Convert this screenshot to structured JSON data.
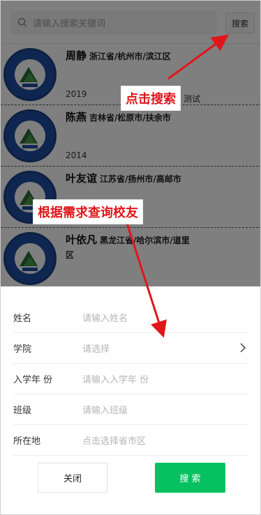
{
  "search": {
    "placeholder": "请输入搜索关键词",
    "button_label": "搜索"
  },
  "alumni": [
    {
      "name": "周静",
      "address": "浙江省/杭州市/滨江区",
      "extra": "测试",
      "year": "2019"
    },
    {
      "name": "陈燕",
      "address": "吉林省/松原市/扶余市",
      "extra": "",
      "year": "2014"
    },
    {
      "name": "叶友谊",
      "address": "江苏省/扬州市/高邮市",
      "extra": "",
      "year": ""
    },
    {
      "name": "叶依凡",
      "address": "黑龙江省/哈尔滨市/道里",
      "address_cont": "区",
      "extra": "",
      "year": ""
    }
  ],
  "filter": {
    "fields": [
      {
        "label": "姓名",
        "placeholder": "请输入姓名"
      },
      {
        "label": "学院",
        "placeholder": "请选择"
      },
      {
        "label": "入学年 份",
        "placeholder": "请输入入学年 份"
      },
      {
        "label": "班级",
        "placeholder": "请输入班级"
      },
      {
        "label": "所在地",
        "placeholder": "点击选择省市区"
      }
    ],
    "close_label": "关闭",
    "search_label": "搜 索"
  },
  "annotations": {
    "click_search": "点击搜索",
    "query_alumni": "根据需求查询校友"
  },
  "colors": {
    "accent_green": "#07c160",
    "annotation_red": "#e0161b",
    "overlay": "rgba(0,0,0,0.5)"
  }
}
